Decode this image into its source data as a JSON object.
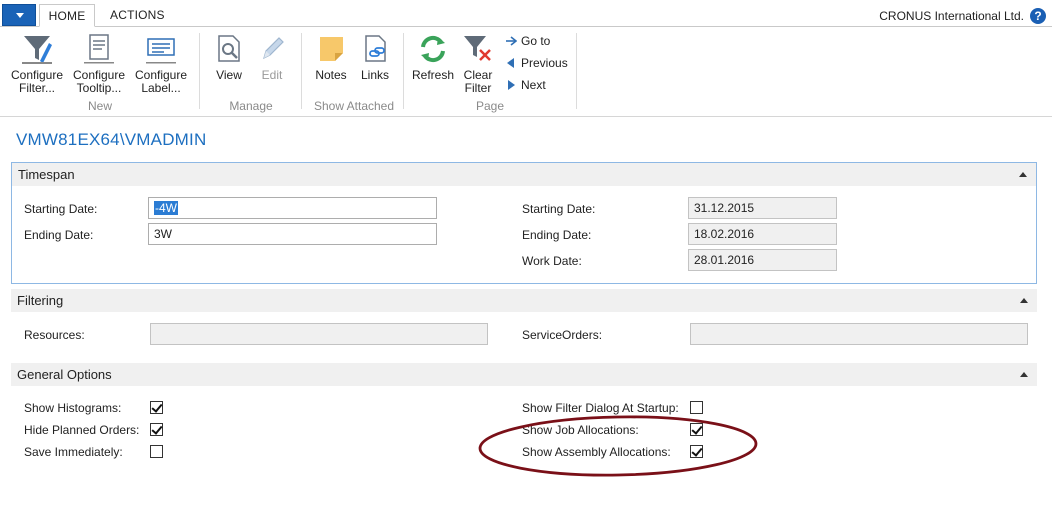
{
  "ribbon": {
    "tabs": [
      {
        "label": "HOME",
        "active": true
      },
      {
        "label": "ACTIONS",
        "active": false
      }
    ],
    "company": "CRONUS International Ltd.",
    "help": "?",
    "groups": {
      "new": {
        "label": "New",
        "buttons": [
          "Configure\nFilter...",
          "Configure\nTooltip...",
          "Configure\nLabel..."
        ]
      },
      "manage": {
        "label": "Manage",
        "buttons": [
          "View",
          "Edit"
        ]
      },
      "show_attached": {
        "label": "Show Attached",
        "buttons": [
          "Notes",
          "Links"
        ]
      },
      "page": {
        "label": "Page",
        "buttons": [
          "Refresh",
          "Clear\nFilter"
        ],
        "nav": [
          "Go to",
          "Previous",
          "Next"
        ]
      }
    }
  },
  "page": {
    "title": "VMW81EX64\\VMADMIN"
  },
  "timespan": {
    "header": "Timespan",
    "left": {
      "starting_date_label": "Starting Date:",
      "starting_date_value": "-4W",
      "ending_date_label": "Ending Date:",
      "ending_date_value": "3W"
    },
    "right": {
      "starting_date_label": "Starting Date:",
      "starting_date_value": "31.12.2015",
      "ending_date_label": "Ending Date:",
      "ending_date_value": "18.02.2016",
      "work_date_label": "Work Date:",
      "work_date_value": "28.01.2016"
    }
  },
  "filtering": {
    "header": "Filtering",
    "resources_label": "Resources:",
    "resources_value": "",
    "service_orders_label": "ServiceOrders:",
    "service_orders_value": ""
  },
  "general_options": {
    "header": "General Options",
    "left": [
      {
        "label": "Show Histograms:",
        "checked": true
      },
      {
        "label": "Hide Planned Orders:",
        "checked": true
      },
      {
        "label": "Save Immediately:",
        "checked": false
      }
    ],
    "right": [
      {
        "label": "Show Filter Dialog At Startup:",
        "checked": false
      },
      {
        "label": "Show Job Allocations:",
        "checked": true
      },
      {
        "label": "Show Assembly Allocations:",
        "checked": true
      }
    ]
  },
  "colors": {
    "accent": "#1d6fc0",
    "app_menu": "#1a63b7",
    "annotation": "#7a1018",
    "focus_border": "#8eb8e4"
  }
}
